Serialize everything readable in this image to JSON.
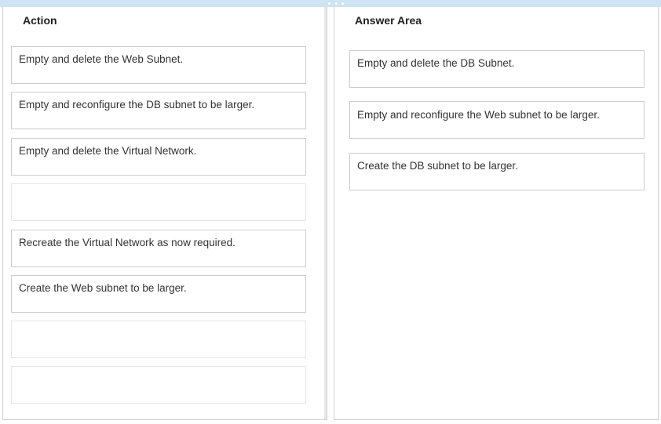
{
  "left_pane": {
    "title": "Action",
    "items": [
      "Empty and delete the Web Subnet.",
      "Empty and reconfigure the DB subnet to be larger.",
      "Empty and delete the Virtual Network.",
      "",
      "Recreate the Virtual Network as now required.",
      "Create the Web subnet to be larger.",
      "",
      ""
    ]
  },
  "right_pane": {
    "title": "Answer Area",
    "items": [
      "Empty and delete the DB Subnet.",
      "Empty and reconfigure the Web subnet to be larger.",
      "Create the DB subnet to be larger."
    ]
  }
}
